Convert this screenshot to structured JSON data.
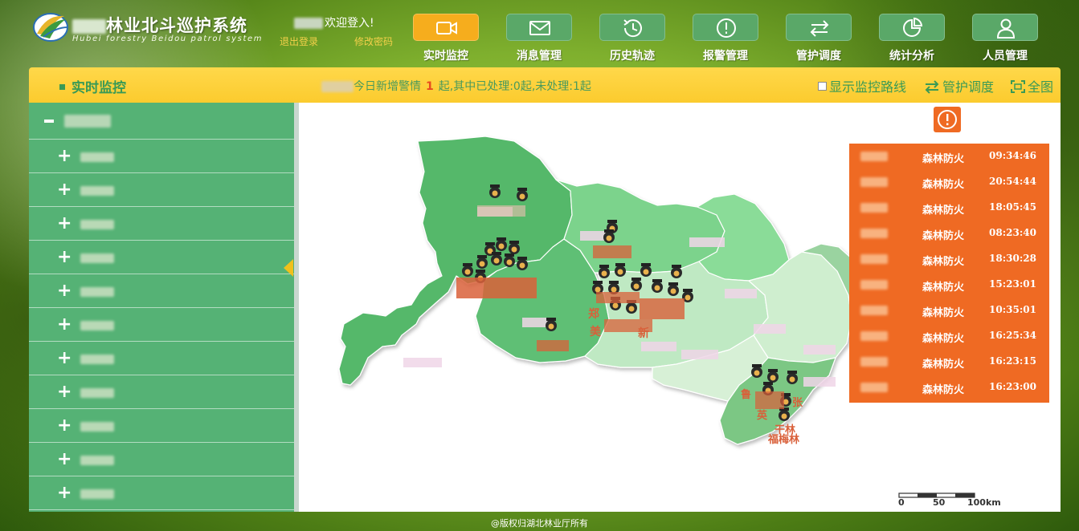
{
  "header": {
    "title_cn": "林业北斗巡护系统",
    "title_en": "Hubei forestry Beidou patrol system",
    "welcome": "欢迎登入!",
    "logout": "退出登录",
    "change_password": "修改密码"
  },
  "nav": [
    {
      "label": "实时监控",
      "icon": "video-camera-icon",
      "active": true
    },
    {
      "label": "消息管理",
      "icon": "envelope-icon",
      "active": false
    },
    {
      "label": "历史轨迹",
      "icon": "clock-history-icon",
      "active": false
    },
    {
      "label": "报警管理",
      "icon": "alert-circle-icon",
      "active": false
    },
    {
      "label": "管护调度",
      "icon": "swap-arrows-icon",
      "active": false
    },
    {
      "label": "统计分析",
      "icon": "pie-chart-icon",
      "active": false
    },
    {
      "label": "人员管理",
      "icon": "user-icon",
      "active": false
    }
  ],
  "toolbar": {
    "title": "实时监控",
    "summary_prefix": "今日新增警情",
    "summary_count": "1",
    "summary_suffix": "起,其中已处理:0起,未处理:1起",
    "show_route": "显示监控路线",
    "dispatch": "管护调度",
    "fullscreen": "全图"
  },
  "alerts": [
    {
      "type": "森林防火",
      "time": "09:34:46"
    },
    {
      "type": "森林防火",
      "time": "20:54:44"
    },
    {
      "type": "森林防火",
      "time": "18:05:45"
    },
    {
      "type": "森林防火",
      "time": "08:23:40"
    },
    {
      "type": "森林防火",
      "time": "18:30:28"
    },
    {
      "type": "森林防火",
      "time": "15:23:01"
    },
    {
      "type": "森林防火",
      "time": "10:35:01"
    },
    {
      "type": "森林防火",
      "time": "16:25:34"
    },
    {
      "type": "森林防火",
      "time": "16:23:15"
    },
    {
      "type": "森林防火",
      "time": "16:23:00"
    }
  ],
  "map_labels": {
    "l1": "郑",
    "l2": "美",
    "l3": "新",
    "l4": "鲁",
    "l5": "英",
    "l6": "张",
    "l7": "干林",
    "l8": "福梅林"
  },
  "scale": {
    "labels": [
      "0",
      "50",
      "100km"
    ]
  },
  "colors": {
    "active_nav": "#f6ad1d",
    "nav": "#5aa868",
    "toolbar": "#fbcb2e",
    "sidebar": "#55b275",
    "alert": "#ef6a23",
    "accent_text": "#3a9a55"
  },
  "footer": "@版权归湖北林业厅所有"
}
